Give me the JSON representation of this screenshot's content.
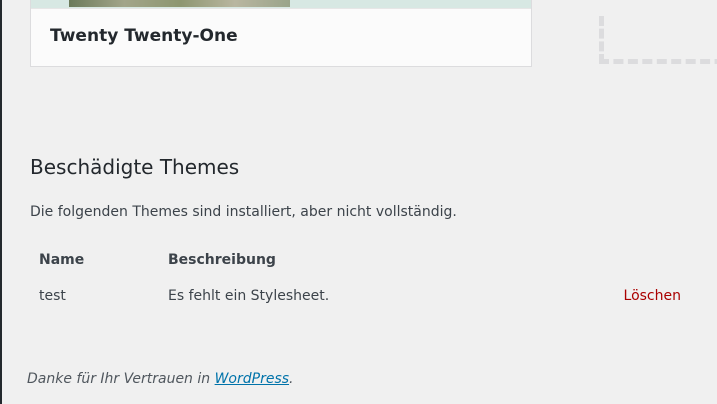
{
  "theme_card": {
    "name": "Twenty Twenty-One"
  },
  "broken_themes": {
    "title": "Beschädigte Themes",
    "description": "Die folgenden Themes sind installiert, aber nicht vollständig.",
    "columns": {
      "name": "Name",
      "description": "Beschreibung"
    },
    "rows": [
      {
        "name": "test",
        "description": "Es fehlt ein Stylesheet.",
        "action": "Löschen"
      }
    ]
  },
  "footer": {
    "text": "Danke für Ihr Vertrauen in ",
    "link": "WordPress",
    "suffix": "."
  },
  "colors": {
    "background": "#f0f0f0",
    "delete_link": "#aa0000",
    "wordpress_link": "#0073aa"
  }
}
